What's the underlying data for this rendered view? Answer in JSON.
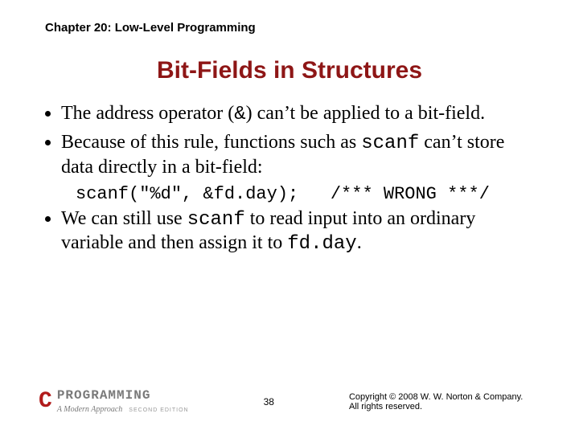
{
  "header": {
    "chapter": "Chapter 20: Low-Level Programming"
  },
  "title": "Bit-Fields in Structures",
  "bullets": {
    "b1_pre": "The address operator (",
    "b1_amp": "&",
    "b1_post": ") can’t be applied to a bit-field.",
    "b2_pre": "Because of this rule, functions such as ",
    "b2_code": "scanf",
    "b2_post": " can’t store data directly in a bit-field:",
    "code_left": "scanf(\"%d\", &fd.day);",
    "code_right": "/*** WRONG ***/",
    "b3_pre": "We can still use ",
    "b3_code1": "scanf",
    "b3_mid": " to read input into an ordinary variable and then assign it to ",
    "b3_code2": "fd.day",
    "b3_post": "."
  },
  "footer": {
    "logo_c": "C",
    "logo_prog": "PROGRAMMING",
    "logo_sub": "A Modern Approach",
    "logo_edition": "SECOND EDITION",
    "page": "38",
    "copyright_l1": "Copyright © 2008 W. W. Norton & Company.",
    "copyright_l2": "All rights reserved."
  }
}
